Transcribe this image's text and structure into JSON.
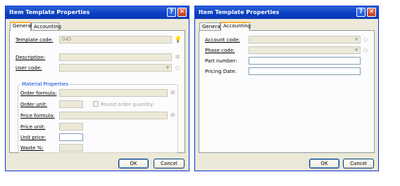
{
  "dialog1": {
    "title": "Item Template Properties",
    "help_btn": "?",
    "close_btn": "✕",
    "tabs": [
      "General",
      "Accounting"
    ],
    "active_tab": "General",
    "fields": {
      "template_code": {
        "label": "Template code:",
        "value": "045"
      },
      "description": {
        "label": "Description:",
        "value": ""
      },
      "user_code": {
        "label": "User code:",
        "value": ""
      }
    },
    "group_title": "Material Properties",
    "material": {
      "order_formula": {
        "label": "Order formula:",
        "value": ""
      },
      "order_unit": {
        "label": "Order unit:",
        "value": ""
      },
      "round_order_quantity": {
        "label": "Round order quantity",
        "checked": false
      },
      "price_formula": {
        "label": "Price formula:",
        "value": ""
      },
      "price_unit": {
        "label": "Price unit:",
        "value": ""
      },
      "unit_price": {
        "label": "Unit price:",
        "value": ""
      },
      "waste": {
        "label": "Waste %:",
        "value": ""
      }
    },
    "ok_label": "OK",
    "cancel_label": "Cancel"
  },
  "dialog2": {
    "title": "Item Template Properties",
    "help_btn": "?",
    "close_btn": "✕",
    "tabs": [
      "General",
      "Accounting"
    ],
    "active_tab": "Accounting",
    "fields": {
      "account_code": {
        "label": "Account code:",
        "value": ""
      },
      "phase_code": {
        "label": "Phase code:",
        "value": ""
      },
      "part_number": {
        "label": "Part number:",
        "value": ""
      },
      "pricing_date": {
        "label": "Pricing Date:",
        "value": ""
      }
    },
    "ok_label": "OK",
    "cancel_label": "Cancel"
  }
}
